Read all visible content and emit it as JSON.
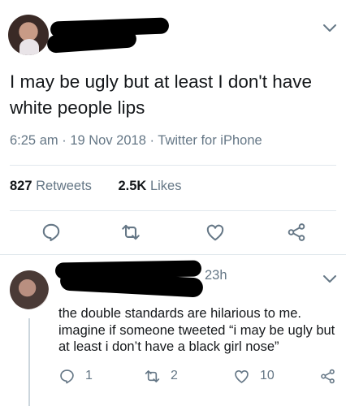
{
  "tweet": {
    "text": "I may be ugly but at least I don't have white people lips",
    "time": "6:25 am",
    "date": "19 Nov 2018",
    "source": "Twitter for iPhone",
    "sep": "·",
    "retweets_count": "827",
    "retweets_label": "Retweets",
    "likes_count": "2.5K",
    "likes_label": "Likes"
  },
  "reply": {
    "time": "23h",
    "text": "the double standards are hilarious to me. imagine if someone tweeted “i may be ugly but at least i don’t have a black girl nose”",
    "reply_count": "1",
    "retweet_count": "2",
    "like_count": "10"
  },
  "icons": [
    "chevron-down-icon",
    "reply-icon",
    "retweet-icon",
    "heart-icon",
    "share-icon"
  ],
  "colors": {
    "muted": "#657786",
    "text": "#14171a",
    "divider": "#e1e8ed",
    "thread": "#ccd6dd",
    "redaction": "#000000"
  }
}
